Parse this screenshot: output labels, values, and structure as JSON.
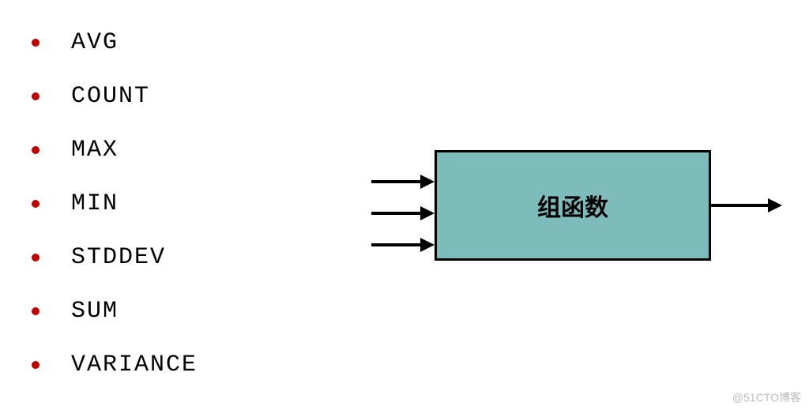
{
  "list": {
    "items": [
      {
        "label": "AVG"
      },
      {
        "label": "COUNT"
      },
      {
        "label": "MAX"
      },
      {
        "label": "MIN"
      },
      {
        "label": "STDDEV"
      },
      {
        "label": "SUM"
      },
      {
        "label": "VARIANCE"
      }
    ]
  },
  "box": {
    "label": "组函数"
  },
  "colors": {
    "bullet": "#C00000",
    "box_fill": "#7EBCBC"
  },
  "watermark": "@51CTO博客"
}
